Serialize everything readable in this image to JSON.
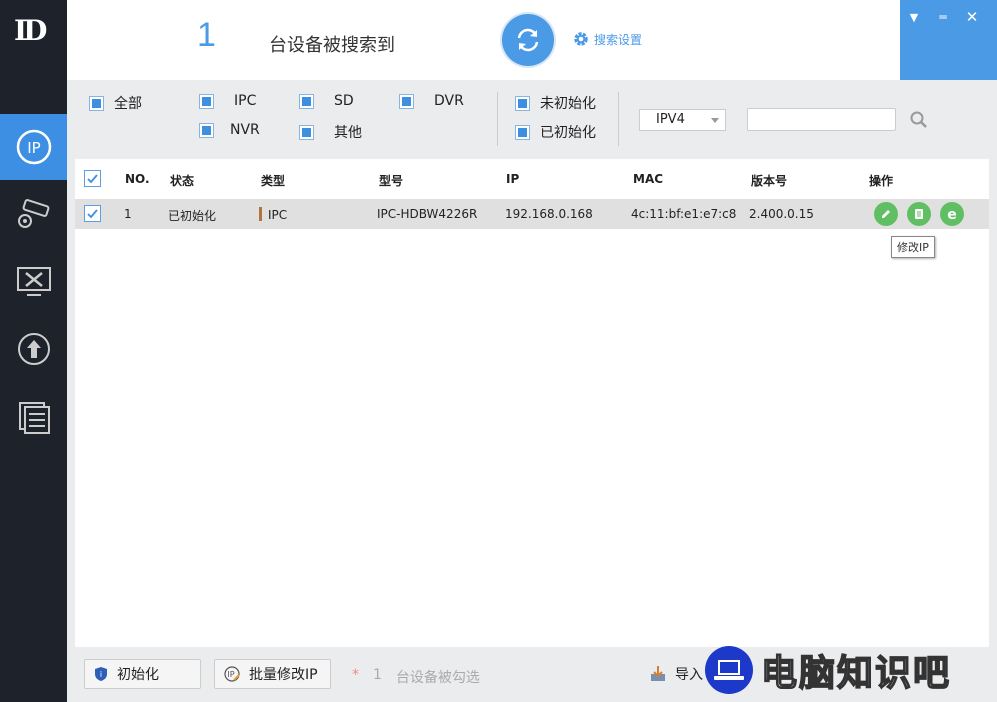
{
  "app": {
    "logo": "ID"
  },
  "header": {
    "device_count": "1",
    "count_label": "台设备被搜索到",
    "search_settings_label": "搜索设置"
  },
  "window_controls": {
    "dropdown": "▼",
    "minimize": "═",
    "close": "✕"
  },
  "sidebar": {
    "items": [
      {
        "name": "ip-tool",
        "active": true
      },
      {
        "name": "camera",
        "active": false
      },
      {
        "name": "tools",
        "active": false
      },
      {
        "name": "upgrade",
        "active": false
      },
      {
        "name": "document",
        "active": false
      }
    ]
  },
  "filters": {
    "all": "全部",
    "ipc": "IPC",
    "sd": "SD",
    "dvr": "DVR",
    "nvr": "NVR",
    "other": "其他",
    "uninitialized": "未初始化",
    "initialized": "已初始化",
    "ip_version": "IPV4",
    "search_placeholder": ""
  },
  "table": {
    "headers": {
      "no": "NO.",
      "status": "状态",
      "type": "类型",
      "model": "型号",
      "ip": "IP",
      "mac": "MAC",
      "version": "版本号",
      "ops": "操作"
    },
    "rows": [
      {
        "no": "1",
        "status": "已初始化",
        "type": "IPC",
        "model": "IPC-HDBW4226R",
        "ip": "192.168.0.168",
        "mac": "4c:11:bf:e1:e7:c8",
        "version": "2.400.0.15"
      }
    ],
    "tooltip": "修改IP"
  },
  "footer": {
    "init_button": "初始化",
    "batch_modify_button": "批量修改IP",
    "star": "*",
    "selected_count": "1",
    "selected_label": "台设备被勾选",
    "import_label": "导入"
  },
  "watermark": {
    "text": "电脑知识吧"
  },
  "colors": {
    "accent": "#4a9ae6",
    "sidebar": "#1d222b",
    "active_nav": "#3c8fe3",
    "op_green": "#5fbf62"
  }
}
